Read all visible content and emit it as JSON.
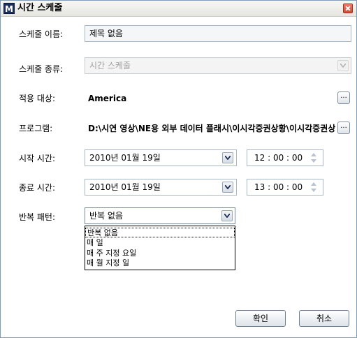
{
  "window": {
    "title": "시간 스케줄",
    "app_icon_letter": "M"
  },
  "form": {
    "name_label": "스케줄 이름:",
    "name_value": "제목 없음",
    "type_label": "스케줄 종류:",
    "type_value": "시간 스케줄",
    "target_label": "적용 대상:",
    "target_value": "America",
    "program_label": "프로그램:",
    "program_value": "D:\\시연 영상\\NE용 외부 데이터 플래시\\이시각증권상황\\이시각증권상황.swf",
    "start_label": "시작 시간:",
    "start_date": "2010년 01월 19일",
    "start_time": "12 : 00 : 00",
    "end_label": "종료 시간:",
    "end_date": "2010년 01월 19일",
    "end_time": "13 : 00 : 00",
    "repeat_label": "반복 패턴:",
    "repeat_value": "반복 없음",
    "dots_label": "..."
  },
  "repeat_options": [
    "반복 없음",
    "매 일",
    "매 주 지정 요일",
    "매 월 지정 일"
  ],
  "buttons": {
    "ok": "확인",
    "cancel": "취소"
  }
}
